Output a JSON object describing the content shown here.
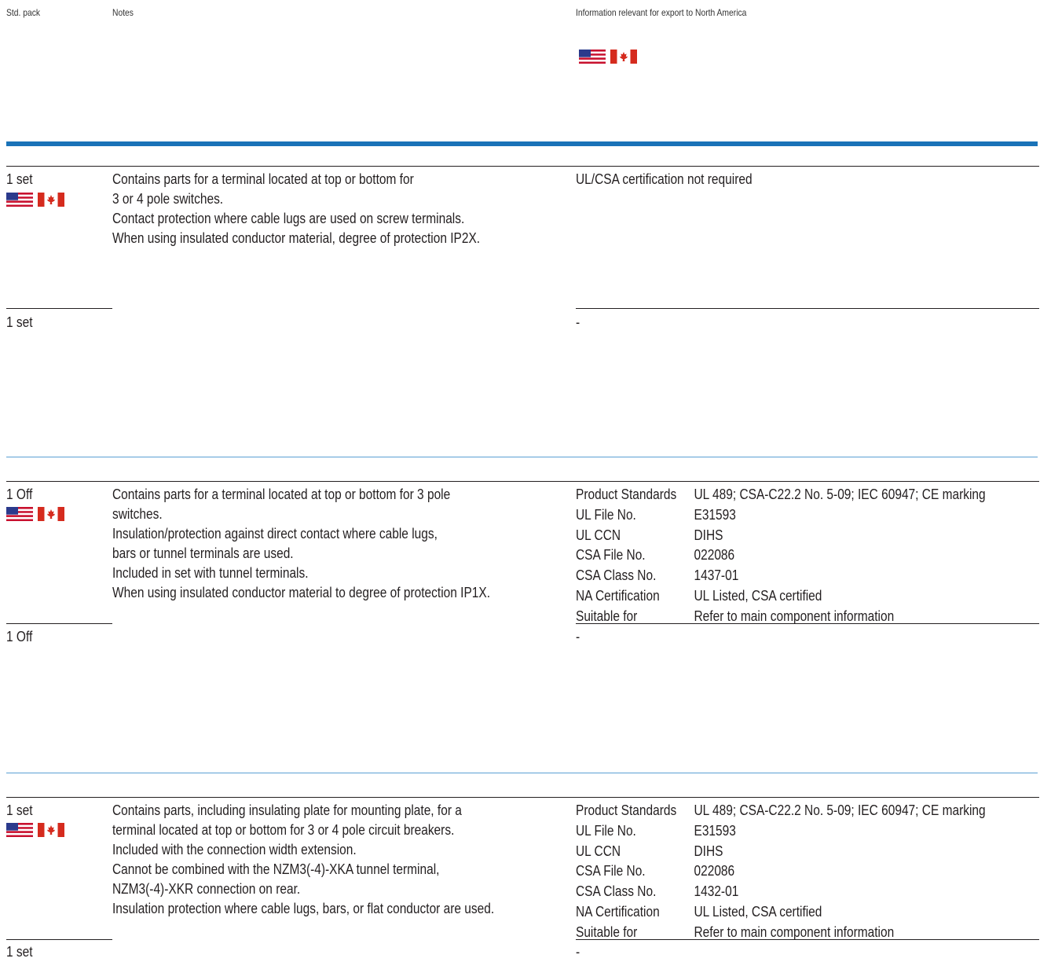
{
  "header": {
    "std_pack": "Std. pack",
    "notes": "Notes",
    "info": "Information relevant for export to North America"
  },
  "flags": {
    "us_flag": "us-flag-icon",
    "ca_flag": "canada-flag-icon",
    "colors": {
      "us_red": "#c8102e",
      "us_blue": "#2b3a8c",
      "ca_red": "#d52b1e",
      "section_bar": "#1a73b8",
      "section_rule": "#5a9fd4"
    }
  },
  "sections": [
    {
      "row1": {
        "std_pack": "1 set",
        "notes": [
          "Contains parts for a terminal located at top or bottom for",
          "3 or 4 pole switches.",
          "Contact protection where cable lugs are used on screw terminals.",
          "When using insulated conductor material, degree of protection IP2X."
        ],
        "info": "UL/CSA certification not required"
      },
      "row2": {
        "std_pack": "1 set",
        "info": "-"
      }
    },
    {
      "row1": {
        "std_pack": "1 Off",
        "notes": [
          "Contains parts for a terminal located at top or bottom for 3 pole",
          "switches.",
          "Insulation/protection against direct contact where cable lugs,",
          "bars or tunnel terminals are used.",
          "Included in set with tunnel terminals.",
          "When using insulated conductor material to degree of protection IP1X."
        ],
        "specs": [
          {
            "label": "Product Standards",
            "value": "UL 489; CSA-C22.2 No. 5-09; IEC 60947; CE marking"
          },
          {
            "label": "UL File No.",
            "value": "E31593"
          },
          {
            "label": "UL CCN",
            "value": "DIHS"
          },
          {
            "label": "CSA File No.",
            "value": "022086"
          },
          {
            "label": "CSA Class No.",
            "value": "1437-01"
          },
          {
            "label": "NA Certification",
            "value": "UL Listed, CSA certified"
          },
          {
            "label": "Suitable for",
            "value": "Refer to main component information"
          }
        ]
      },
      "row2": {
        "std_pack": "1 Off",
        "info": "-"
      }
    },
    {
      "row1": {
        "std_pack": "1 set",
        "notes": [
          "Contains parts, including insulating plate for mounting plate, for a",
          "terminal located at top or bottom for 3 or 4 pole circuit breakers.",
          "Included with the connection width extension.",
          "Cannot be combined with the NZM3(-4)-XKA tunnel terminal,",
          "NZM3(-4)-XKR connection on rear.",
          "Insulation protection where cable lugs, bars, or flat conductor are used."
        ],
        "specs": [
          {
            "label": "Product Standards",
            "value": "UL 489; CSA-C22.2 No. 5-09; IEC 60947; CE marking"
          },
          {
            "label": "UL File No.",
            "value": "E31593"
          },
          {
            "label": "UL CCN",
            "value": "DIHS"
          },
          {
            "label": "CSA File No.",
            "value": "022086"
          },
          {
            "label": "CSA Class No.",
            "value": "1432-01"
          },
          {
            "label": "NA Certification",
            "value": "UL Listed, CSA certified"
          },
          {
            "label": "Suitable for",
            "value": "Refer to main component information"
          }
        ]
      },
      "row2": {
        "std_pack": "1 set",
        "info": "-"
      }
    }
  ]
}
